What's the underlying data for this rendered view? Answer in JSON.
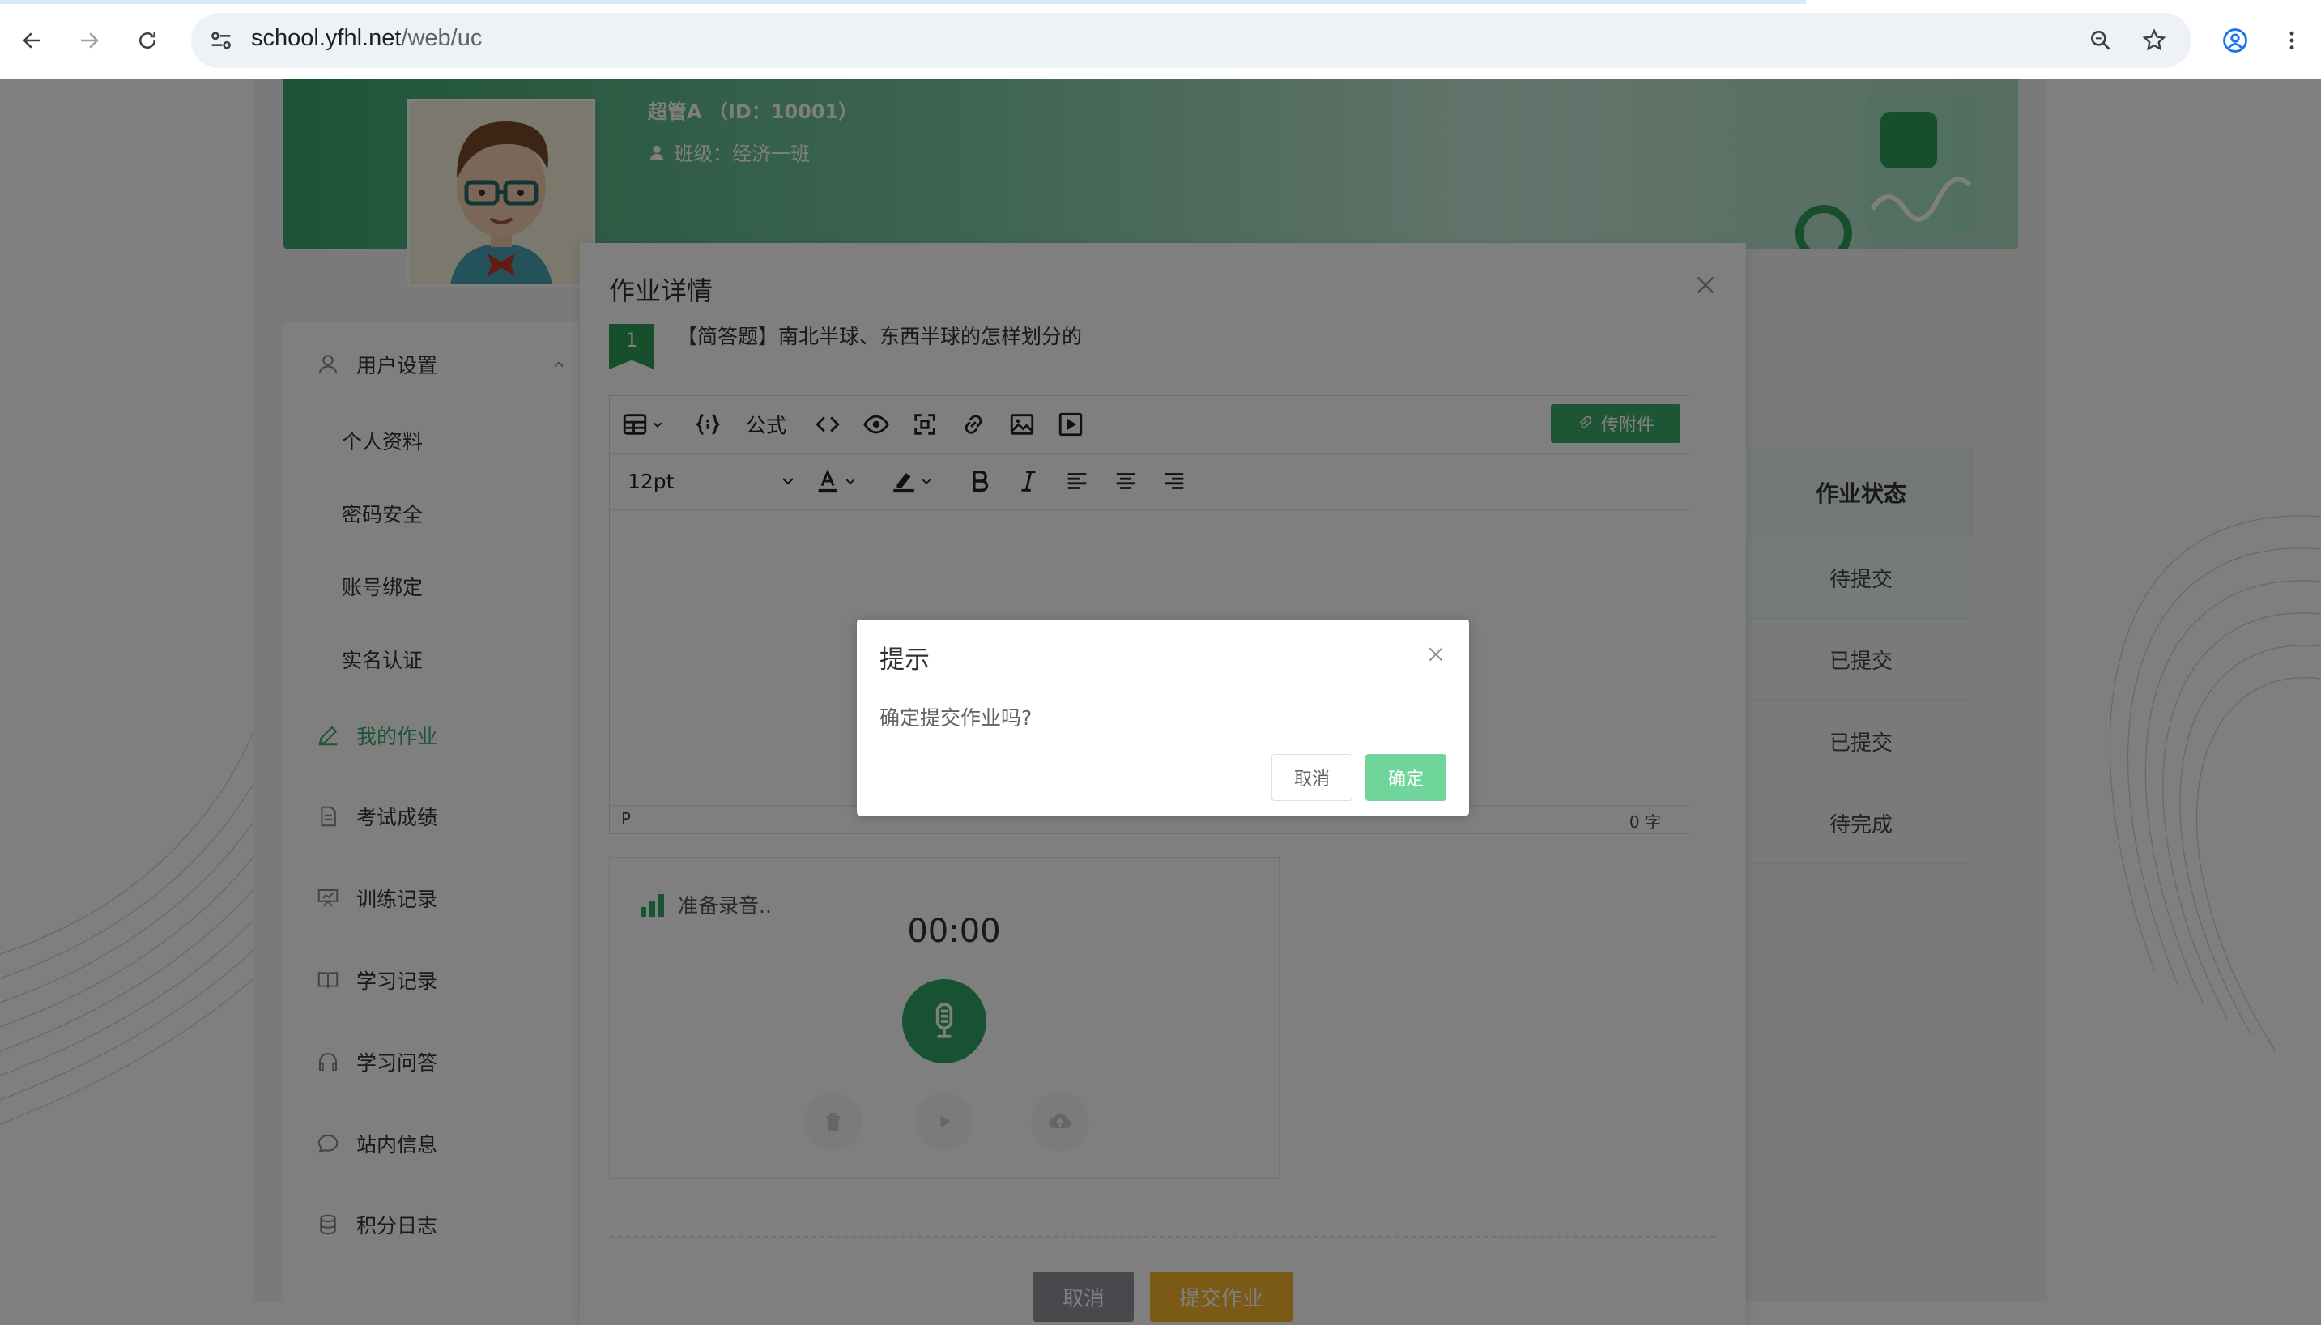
{
  "browser": {
    "url_host": "school.yfhl.net",
    "url_path": "/web/uc"
  },
  "profile": {
    "name": "超管A （ID：10001）",
    "class_label": "班级：经济一班"
  },
  "sidebar": {
    "user_settings": "用户设置",
    "sub_items": [
      "个人资料",
      "密码安全",
      "账号绑定",
      "实名认证"
    ],
    "items": [
      {
        "label": "我的作业",
        "icon": "pencil-icon"
      },
      {
        "label": "考试成绩",
        "icon": "document-icon"
      },
      {
        "label": "训练记录",
        "icon": "presentation-icon"
      },
      {
        "label": "学习记录",
        "icon": "book-icon"
      },
      {
        "label": "学习问答",
        "icon": "headset-icon"
      },
      {
        "label": "站内信息",
        "icon": "chat-icon"
      },
      {
        "label": "积分日志",
        "icon": "database-icon"
      }
    ]
  },
  "table": {
    "status_header": "作业状态",
    "statuses": [
      "待提交",
      "已提交",
      "已提交",
      "待完成"
    ]
  },
  "hw_dialog": {
    "title": "作业详情",
    "question_number": "1",
    "question_text": "【简答题】南北半球、东西半球的怎样划分的",
    "editor": {
      "formula_label": "公式",
      "font_size": "12pt",
      "attach_label": "传附件",
      "status_p": "P",
      "word_count": "0 字"
    },
    "recorder": {
      "state_text": "准备录音..",
      "time": "00:00"
    },
    "cancel_label": "取消",
    "submit_label": "提交作业"
  },
  "confirm": {
    "title": "提示",
    "message": "确定提交作业吗?",
    "cancel_label": "取消",
    "ok_label": "确定"
  },
  "colors": {
    "primary_green": "#37a96a",
    "submit_yellow": "#f5b52a",
    "confirm_ok": "#6fd59a"
  }
}
